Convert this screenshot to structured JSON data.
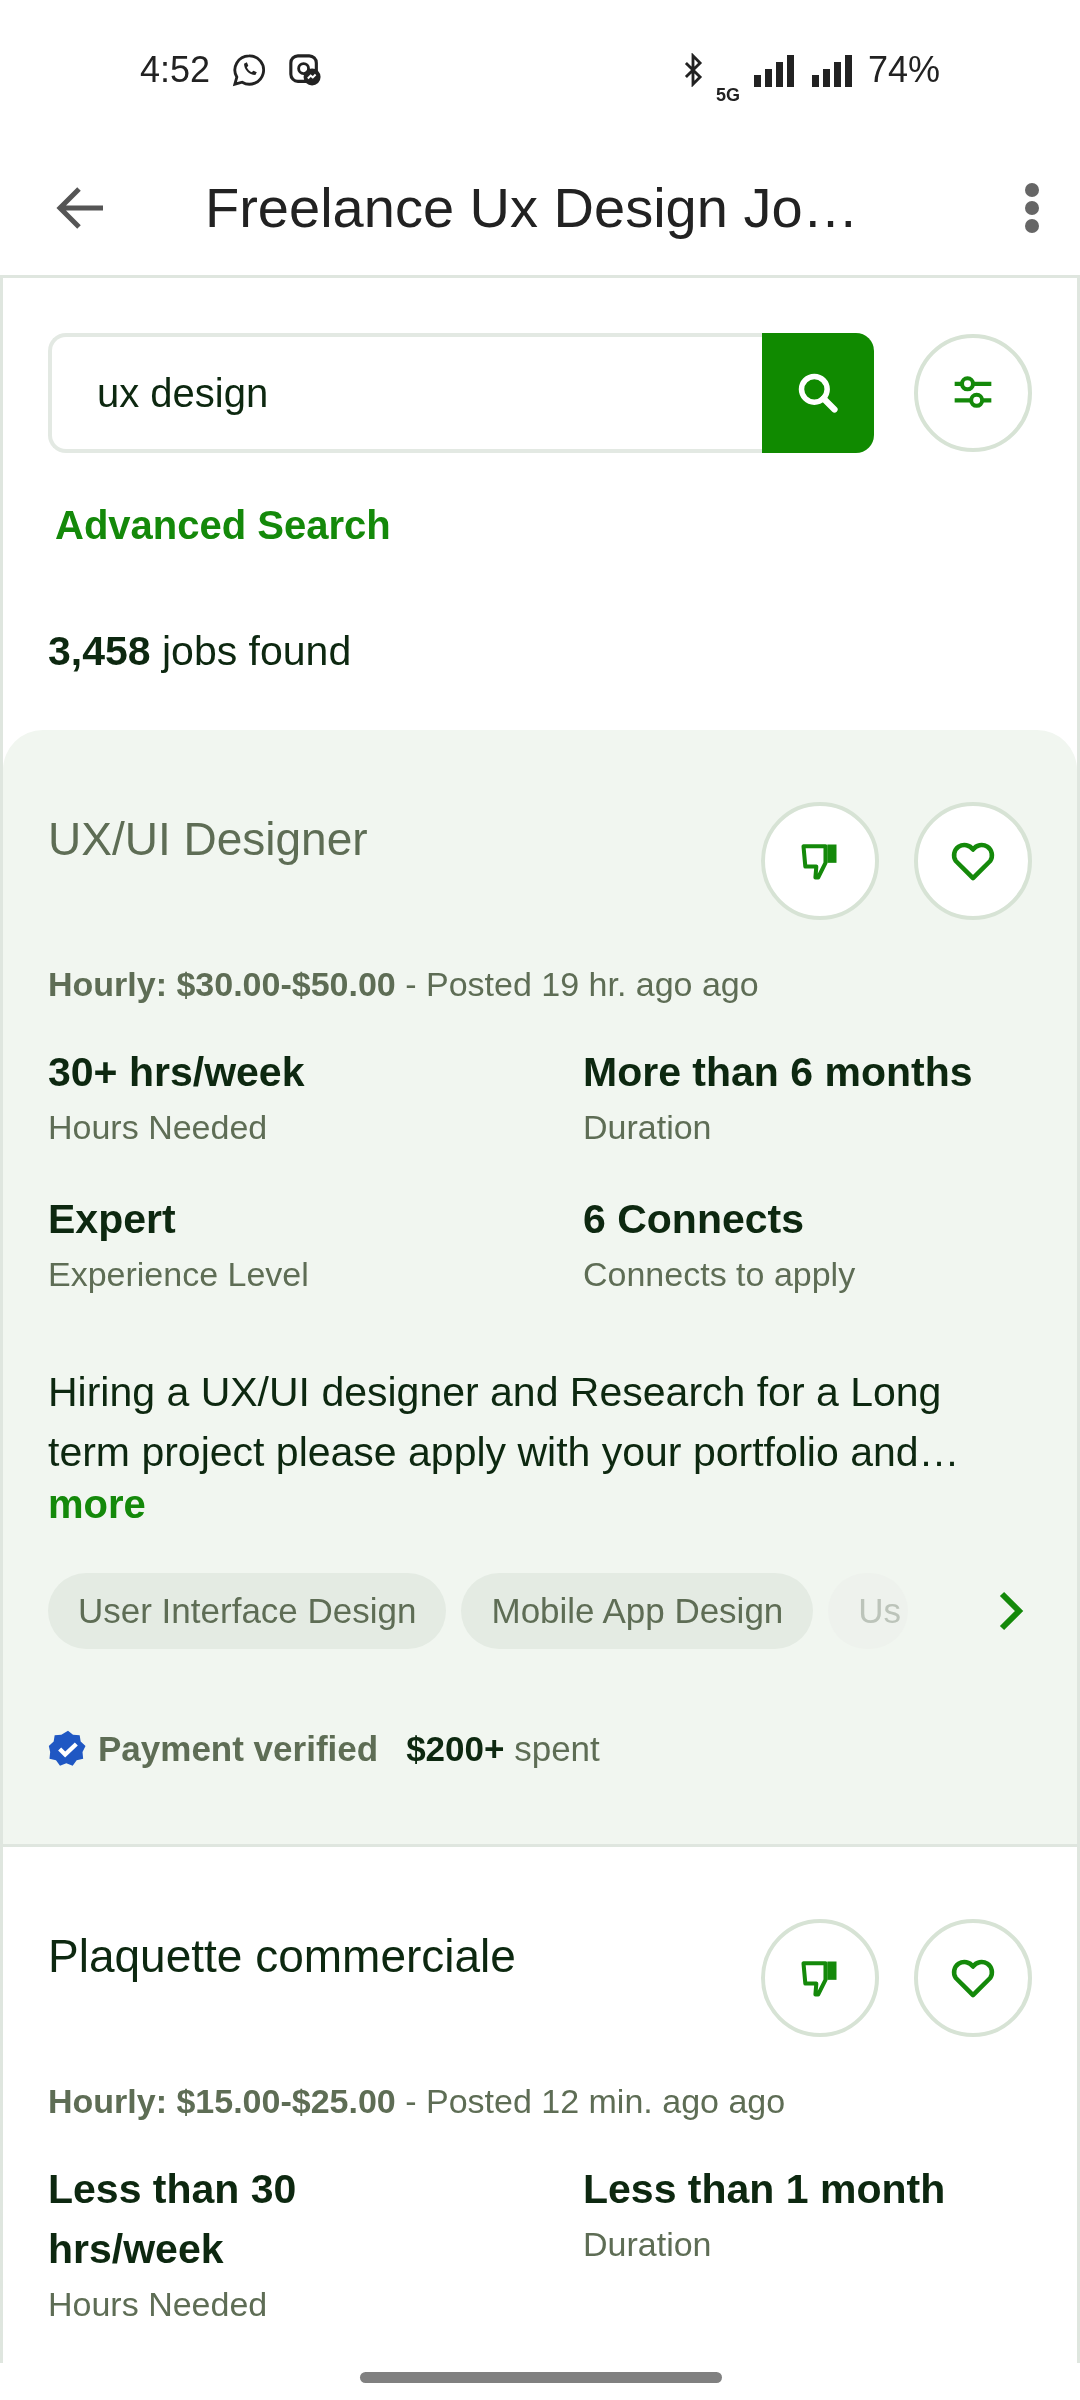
{
  "status_bar": {
    "time": "4:52",
    "network": "5G",
    "battery": "74%"
  },
  "app_bar": {
    "title": "Freelance Ux Design Jo…"
  },
  "search": {
    "value": "ux design",
    "advanced_link": "Advanced Search"
  },
  "results": "**3,458** jobs found",
  "jobs": [
    {
      "viewed": true,
      "title": "UX/UI Designer",
      "meta": "**Hourly: $30.00-$50.00** - Posted 19 hr. ago ago",
      "stats": [
        {
          "value": "30+ hrs/week",
          "label": "Hours Needed"
        },
        {
          "value": "More than 6 months",
          "label": "Duration"
        },
        {
          "value": "Expert",
          "label": "Experience Level"
        },
        {
          "value": "6 Connects",
          "label": "Connects to apply"
        }
      ],
      "description": "Hiring a UX/UI designer and Research for a Long term project please apply with your portfolio and…",
      "more": "more",
      "skills": [
        "User Interface Design",
        "Mobile App Design",
        "Us"
      ],
      "payment_verified": true,
      "payment_label": "Payment verified",
      "spent": "**$200+** spent"
    },
    {
      "viewed": false,
      "title": "Plaquette commerciale",
      "meta": "**Hourly: $15.00-$25.00** - Posted 12 min. ago ago",
      "stats": [
        {
          "value": "Less than 30 hrs/week",
          "label": "Hours Needed"
        },
        {
          "value": "Less than 1 month",
          "label": "Duration"
        }
      ]
    }
  ]
}
